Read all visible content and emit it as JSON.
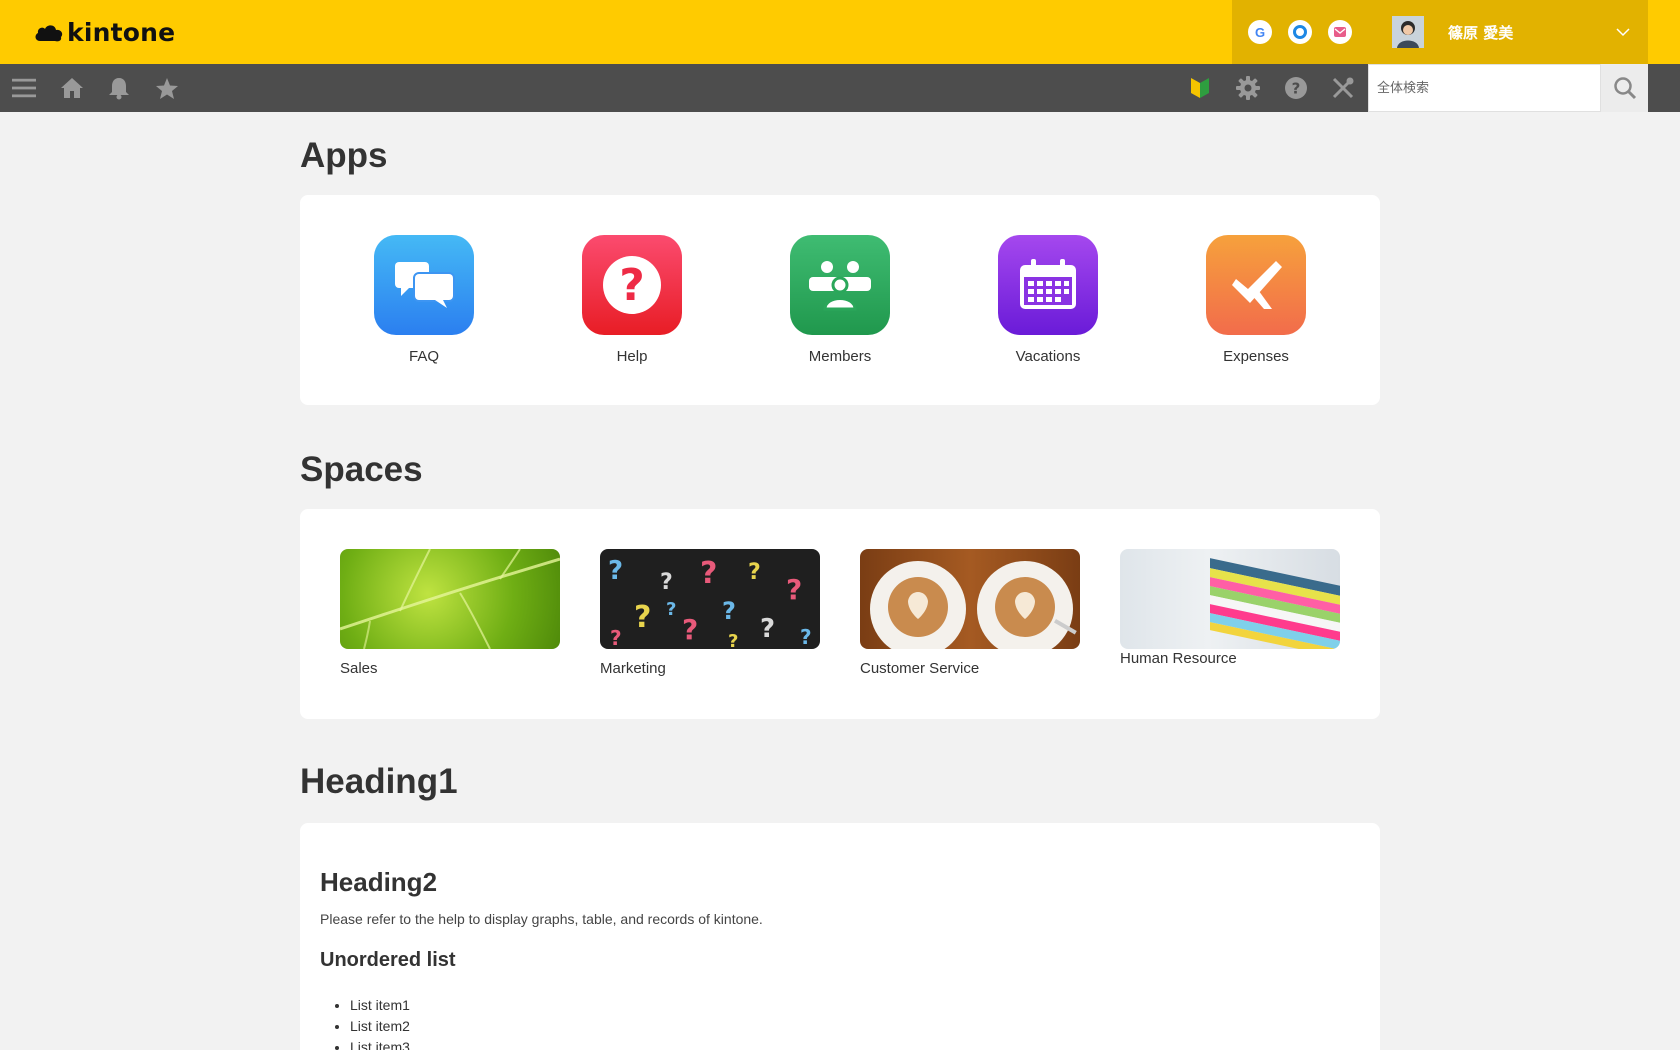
{
  "brand": {
    "name": "kintone"
  },
  "header": {
    "notifications": [
      {
        "icon": "google-icon",
        "glyph": "G",
        "color": "#4285f4"
      },
      {
        "icon": "circle-app-icon",
        "glyph": "O",
        "color": "#1e88e5"
      },
      {
        "icon": "mail-icon",
        "glyph": "✉",
        "color": "#e91e63"
      }
    ],
    "user_name": "篠原 愛美"
  },
  "toolbar": {
    "search_placeholder": "全体検索"
  },
  "apps": {
    "title": "Apps",
    "items": [
      {
        "label": "FAQ",
        "icon": "chat-bubbles-icon"
      },
      {
        "label": "Help",
        "icon": "question-icon"
      },
      {
        "label": "Members",
        "icon": "people-icon"
      },
      {
        "label": "Vacations",
        "icon": "calendar-icon"
      },
      {
        "label": "Expenses",
        "icon": "plane-icon"
      }
    ]
  },
  "spaces": {
    "title": "Spaces",
    "items": [
      {
        "label": "Sales"
      },
      {
        "label": "Marketing"
      },
      {
        "label": "Customer Service"
      },
      {
        "label": "Human Resource"
      }
    ]
  },
  "content": {
    "heading1": "Heading1",
    "heading2": "Heading2",
    "paragraph": "Please refer to the help to display graphs, table, and records of kintone.",
    "heading3": "Unordered list",
    "list": [
      "List item1",
      "List item2",
      "List item3"
    ]
  },
  "colors": {
    "header_bg": "#ffcb00",
    "toolbar_bg": "#4d4d4d",
    "page_bg": "#f2f2f2"
  }
}
